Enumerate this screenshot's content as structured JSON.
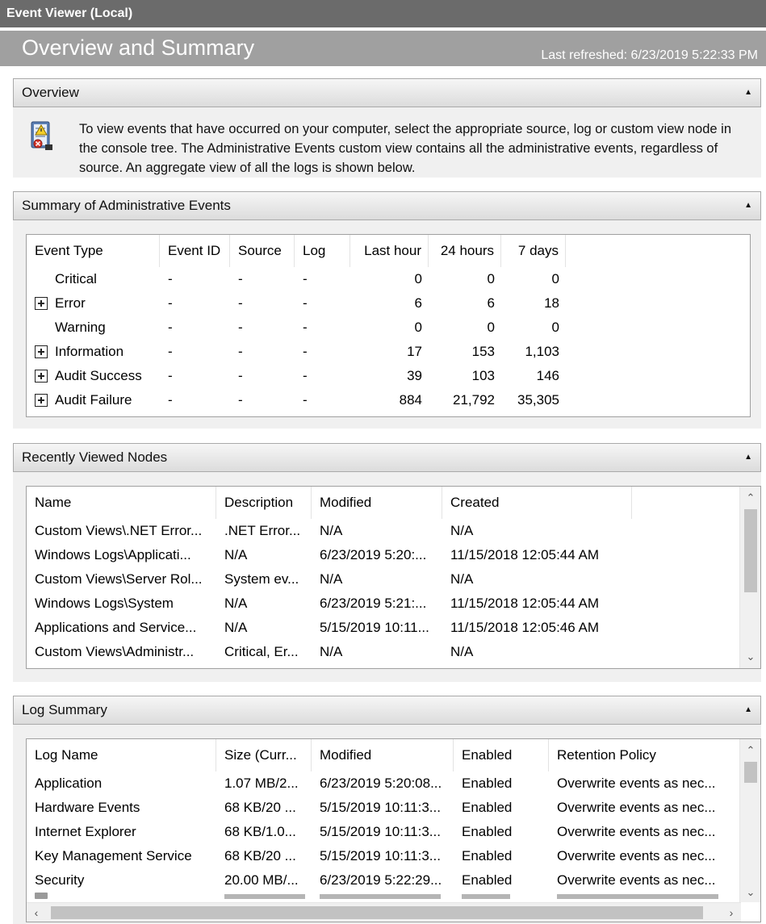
{
  "window": {
    "title": "Event Viewer (Local)"
  },
  "banner": {
    "title": "Overview and Summary",
    "last_refreshed": "Last refreshed: 6/23/2019 5:22:33 PM"
  },
  "overview": {
    "header": "Overview",
    "icon": "event-log-icon",
    "text": "To view events that have occurred on your computer, select the appropriate source, log or custom view node in the console tree. The Administrative Events custom view contains all the administrative events, regardless of source. An aggregate view of all the logs is shown below."
  },
  "summary": {
    "header": "Summary of Administrative Events",
    "columns": [
      "Event Type",
      "Event ID",
      "Source",
      "Log",
      "Last hour",
      "24 hours",
      "7 days"
    ],
    "rows": [
      {
        "type": "Critical",
        "expandable": false,
        "event_id": "-",
        "source": "-",
        "log": "-",
        "last_hour": "0",
        "h24": "0",
        "d7": "0"
      },
      {
        "type": "Error",
        "expandable": true,
        "event_id": "-",
        "source": "-",
        "log": "-",
        "last_hour": "6",
        "h24": "6",
        "d7": "18"
      },
      {
        "type": "Warning",
        "expandable": false,
        "event_id": "-",
        "source": "-",
        "log": "-",
        "last_hour": "0",
        "h24": "0",
        "d7": "0"
      },
      {
        "type": "Information",
        "expandable": true,
        "event_id": "-",
        "source": "-",
        "log": "-",
        "last_hour": "17",
        "h24": "153",
        "d7": "1,103"
      },
      {
        "type": "Audit Success",
        "expandable": true,
        "event_id": "-",
        "source": "-",
        "log": "-",
        "last_hour": "39",
        "h24": "103",
        "d7": "146"
      },
      {
        "type": "Audit Failure",
        "expandable": true,
        "event_id": "-",
        "source": "-",
        "log": "-",
        "last_hour": "884",
        "h24": "21,792",
        "d7": "35,305"
      }
    ]
  },
  "recent": {
    "header": "Recently Viewed Nodes",
    "columns": [
      "Name",
      "Description",
      "Modified",
      "Created"
    ],
    "rows": [
      [
        "Custom Views\\.NET Error...",
        ".NET Error...",
        "N/A",
        "N/A"
      ],
      [
        "Windows Logs\\Applicati...",
        "N/A",
        "6/23/2019 5:20:...",
        "11/15/2018 12:05:44 AM"
      ],
      [
        "Custom Views\\Server Rol...",
        "System ev...",
        "N/A",
        "N/A"
      ],
      [
        "Windows Logs\\System",
        "N/A",
        "6/23/2019 5:21:...",
        "11/15/2018 12:05:44 AM"
      ],
      [
        "Applications and Service...",
        "N/A",
        "5/15/2019 10:11...",
        "11/15/2018 12:05:46 AM"
      ],
      [
        "Custom Views\\Administr...",
        "Critical, Er...",
        "N/A",
        "N/A"
      ]
    ]
  },
  "logsummary": {
    "header": "Log Summary",
    "columns": [
      "Log Name",
      "Size (Curr...",
      "Modified",
      "Enabled",
      "Retention Policy"
    ],
    "rows": [
      [
        "Application",
        "1.07 MB/2...",
        "6/23/2019 5:20:08...",
        "Enabled",
        "Overwrite events as nec..."
      ],
      [
        "Hardware Events",
        "68 KB/20 ...",
        "5/15/2019 10:11:3...",
        "Enabled",
        "Overwrite events as nec..."
      ],
      [
        "Internet Explorer",
        "68 KB/1.0...",
        "5/15/2019 10:11:3...",
        "Enabled",
        "Overwrite events as nec..."
      ],
      [
        "Key Management Service",
        "68 KB/20 ...",
        "5/15/2019 10:11:3...",
        "Enabled",
        "Overwrite events as nec..."
      ],
      [
        "Security",
        "20.00 MB/...",
        "6/23/2019 5:22:29...",
        "Enabled",
        "Overwrite events as nec..."
      ]
    ]
  }
}
